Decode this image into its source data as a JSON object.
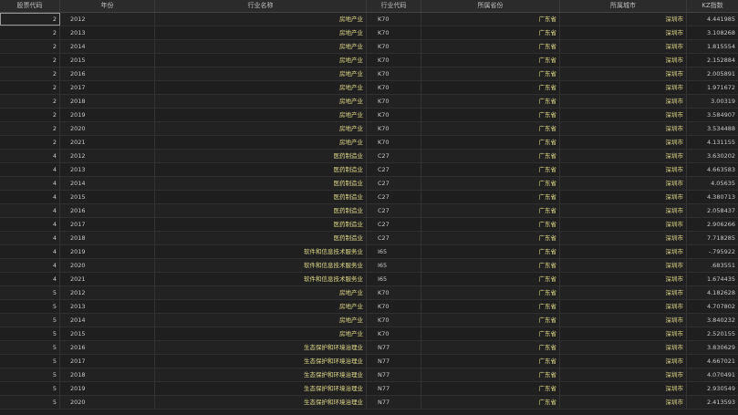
{
  "columns": [
    "股票代码",
    "年份",
    "行业名称",
    "行业代码",
    "所属省份",
    "所属城市",
    "KZ指数"
  ],
  "rows": [
    [
      "2",
      "2012",
      "房地产业",
      "K70",
      "广东省",
      "深圳市",
      "4.441985"
    ],
    [
      "2",
      "2013",
      "房地产业",
      "K70",
      "广东省",
      "深圳市",
      "3.108268"
    ],
    [
      "2",
      "2014",
      "房地产业",
      "K70",
      "广东省",
      "深圳市",
      "1.815554"
    ],
    [
      "2",
      "2015",
      "房地产业",
      "K70",
      "广东省",
      "深圳市",
      "2.152884"
    ],
    [
      "2",
      "2016",
      "房地产业",
      "K70",
      "广东省",
      "深圳市",
      "2.005891"
    ],
    [
      "2",
      "2017",
      "房地产业",
      "K70",
      "广东省",
      "深圳市",
      "1.971672"
    ],
    [
      "2",
      "2018",
      "房地产业",
      "K70",
      "广东省",
      "深圳市",
      "3.00319"
    ],
    [
      "2",
      "2019",
      "房地产业",
      "K70",
      "广东省",
      "深圳市",
      "3.584907"
    ],
    [
      "2",
      "2020",
      "房地产业",
      "K70",
      "广东省",
      "深圳市",
      "3.534488"
    ],
    [
      "2",
      "2021",
      "房地产业",
      "K70",
      "广东省",
      "深圳市",
      "4.131155"
    ],
    [
      "4",
      "2012",
      "医药制造业",
      "C27",
      "广东省",
      "深圳市",
      "3.630202"
    ],
    [
      "4",
      "2013",
      "医药制造业",
      "C27",
      "广东省",
      "深圳市",
      "4.663583"
    ],
    [
      "4",
      "2014",
      "医药制造业",
      "C27",
      "广东省",
      "深圳市",
      "4.05635"
    ],
    [
      "4",
      "2015",
      "医药制造业",
      "C27",
      "广东省",
      "深圳市",
      "4.380713"
    ],
    [
      "4",
      "2016",
      "医药制造业",
      "C27",
      "广东省",
      "深圳市",
      "2.058437"
    ],
    [
      "4",
      "2017",
      "医药制造业",
      "C27",
      "广东省",
      "深圳市",
      "2.906266"
    ],
    [
      "4",
      "2018",
      "医药制造业",
      "C27",
      "广东省",
      "深圳市",
      "7.718285"
    ],
    [
      "4",
      "2019",
      "软件和信息技术服务业",
      "I65",
      "广东省",
      "深圳市",
      "-.795922"
    ],
    [
      "4",
      "2020",
      "软件和信息技术服务业",
      "I65",
      "广东省",
      "深圳市",
      ".683551"
    ],
    [
      "4",
      "2021",
      "软件和信息技术服务业",
      "I65",
      "广东省",
      "深圳市",
      "1.674435"
    ],
    [
      "5",
      "2012",
      "房地产业",
      "K70",
      "广东省",
      "深圳市",
      "4.182628"
    ],
    [
      "5",
      "2013",
      "房地产业",
      "K70",
      "广东省",
      "深圳市",
      "4.707802"
    ],
    [
      "5",
      "2014",
      "房地产业",
      "K70",
      "广东省",
      "深圳市",
      "3.840232"
    ],
    [
      "5",
      "2015",
      "房地产业",
      "K70",
      "广东省",
      "深圳市",
      "2.520155"
    ],
    [
      "5",
      "2016",
      "生态保护和环境治理业",
      "N77",
      "广东省",
      "深圳市",
      "3.830629"
    ],
    [
      "5",
      "2017",
      "生态保护和环境治理业",
      "N77",
      "广东省",
      "深圳市",
      "4.667021"
    ],
    [
      "5",
      "2018",
      "生态保护和环境治理业",
      "N77",
      "广东省",
      "深圳市",
      "4.070491"
    ],
    [
      "5",
      "2019",
      "生态保护和环境治理业",
      "N77",
      "广东省",
      "深圳市",
      "2.930549"
    ],
    [
      "5",
      "2020",
      "生态保护和环境治理业",
      "N77",
      "广东省",
      "深圳市",
      "2.413593"
    ]
  ]
}
